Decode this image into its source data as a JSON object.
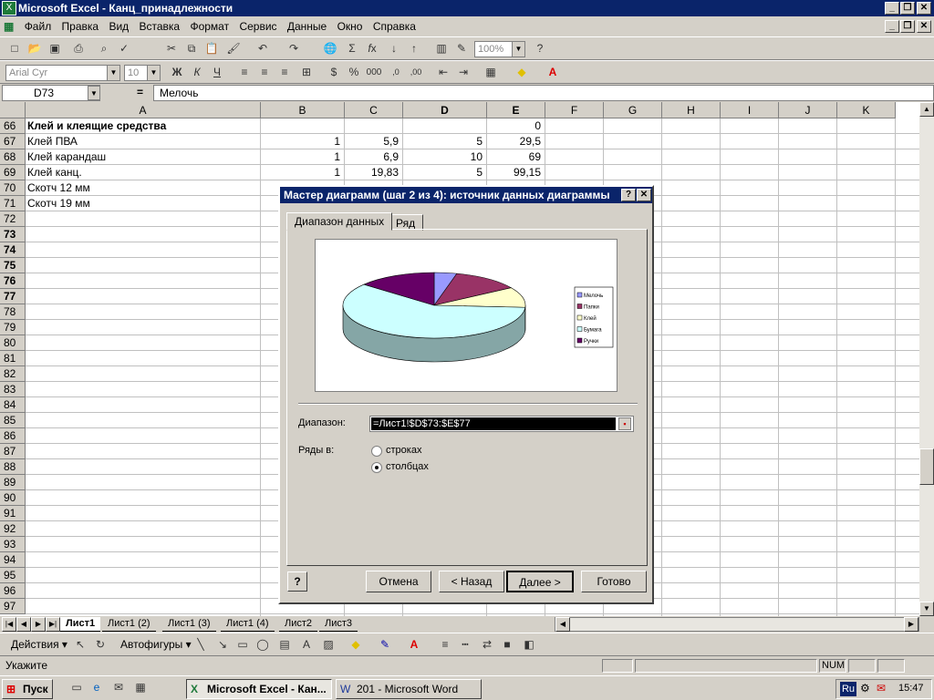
{
  "window": {
    "title": "Microsoft Excel - Канц_принадлежности",
    "icon": "excel-icon"
  },
  "menu": [
    "Файл",
    "Правка",
    "Вид",
    "Вставка",
    "Формат",
    "Сервис",
    "Данные",
    "Окно",
    "Справка"
  ],
  "toolbar": {
    "zoom": "100%",
    "font": "Arial Cyr",
    "size": "10"
  },
  "formula": {
    "cell": "D73",
    "fx": "=",
    "value": "Мелочь"
  },
  "columns": [
    "A",
    "B",
    "C",
    "D",
    "E",
    "F",
    "G",
    "H",
    "I",
    "J",
    "K"
  ],
  "rows": [
    {
      "n": "66",
      "bold": false,
      "a": "Клей и клеящие средства",
      "b": "",
      "c": "",
      "d": "",
      "e": "0",
      "boldA": true
    },
    {
      "n": "67",
      "bold": false,
      "a": "Клей ПВА",
      "b": "1",
      "c": "5,9",
      "d": "5",
      "e": "29,5"
    },
    {
      "n": "68",
      "bold": false,
      "a": "Клей карандаш",
      "b": "1",
      "c": "6,9",
      "d": "10",
      "e": "69"
    },
    {
      "n": "69",
      "bold": false,
      "a": "Клей канц.",
      "b": "1",
      "c": "19,83",
      "d": "5",
      "e": "99,15"
    },
    {
      "n": "70",
      "bold": false,
      "a": "Скотч 12 мм",
      "b": "",
      "c": "",
      "d": "",
      "e": ""
    },
    {
      "n": "71",
      "bold": false,
      "a": "Скотч 19 мм",
      "b": "",
      "c": "",
      "d": "",
      "e": ""
    },
    {
      "n": "72",
      "bold": false
    },
    {
      "n": "73",
      "bold": true
    },
    {
      "n": "74",
      "bold": true
    },
    {
      "n": "75",
      "bold": true
    },
    {
      "n": "76",
      "bold": true
    },
    {
      "n": "77",
      "bold": true
    },
    {
      "n": "78",
      "bold": false
    },
    {
      "n": "79",
      "bold": false
    },
    {
      "n": "80",
      "bold": false
    },
    {
      "n": "81",
      "bold": false
    },
    {
      "n": "82",
      "bold": false
    },
    {
      "n": "83",
      "bold": false
    },
    {
      "n": "84",
      "bold": false
    },
    {
      "n": "85",
      "bold": false
    },
    {
      "n": "86",
      "bold": false
    },
    {
      "n": "87",
      "bold": false
    },
    {
      "n": "88",
      "bold": false
    },
    {
      "n": "89",
      "bold": false
    },
    {
      "n": "90",
      "bold": false
    },
    {
      "n": "91",
      "bold": false
    },
    {
      "n": "92",
      "bold": false
    },
    {
      "n": "93",
      "bold": false
    },
    {
      "n": "94",
      "bold": false
    },
    {
      "n": "95",
      "bold": false
    },
    {
      "n": "96",
      "bold": false
    },
    {
      "n": "97",
      "bold": false
    }
  ],
  "sheets": [
    "Лист1",
    "Лист1 (2)",
    "Лист1 (3)",
    "Лист1 (4)",
    "Лист2",
    "Лист3"
  ],
  "drawbar": {
    "actions": "Действия",
    "autoshapes": "Автофигуры"
  },
  "status": {
    "text": "Укажите",
    "num": "NUM"
  },
  "taskbar": {
    "start": "Пуск",
    "task1": "Microsoft Excel - Кан...",
    "task2": "201 - Microsoft Word",
    "lang": "Ru",
    "clock": "15:47"
  },
  "dialog": {
    "title": "Мастер диаграмм (шаг 2 из 4): источник данных диаграммы",
    "tabs": [
      "Диапазон данных",
      "Ряд"
    ],
    "range_label": "Диапазон:",
    "range_value": "=Лист1!$D$73:$E$77",
    "series_label": "Ряды в:",
    "opt_rows": "строках",
    "opt_cols": "столбцах",
    "buttons": {
      "cancel": "Отмена",
      "back": "< Назад",
      "next": "Далее >",
      "finish": "Готово"
    }
  },
  "chart_data": {
    "type": "pie",
    "categories": [
      "Мелочь",
      "Папки",
      "Клей",
      "Бумага",
      "Ручки"
    ],
    "values": [
      4,
      12,
      10,
      60,
      14
    ],
    "colors": [
      "#9999ff",
      "#993366",
      "#ffffcc",
      "#ccffff",
      "#660066"
    ]
  }
}
